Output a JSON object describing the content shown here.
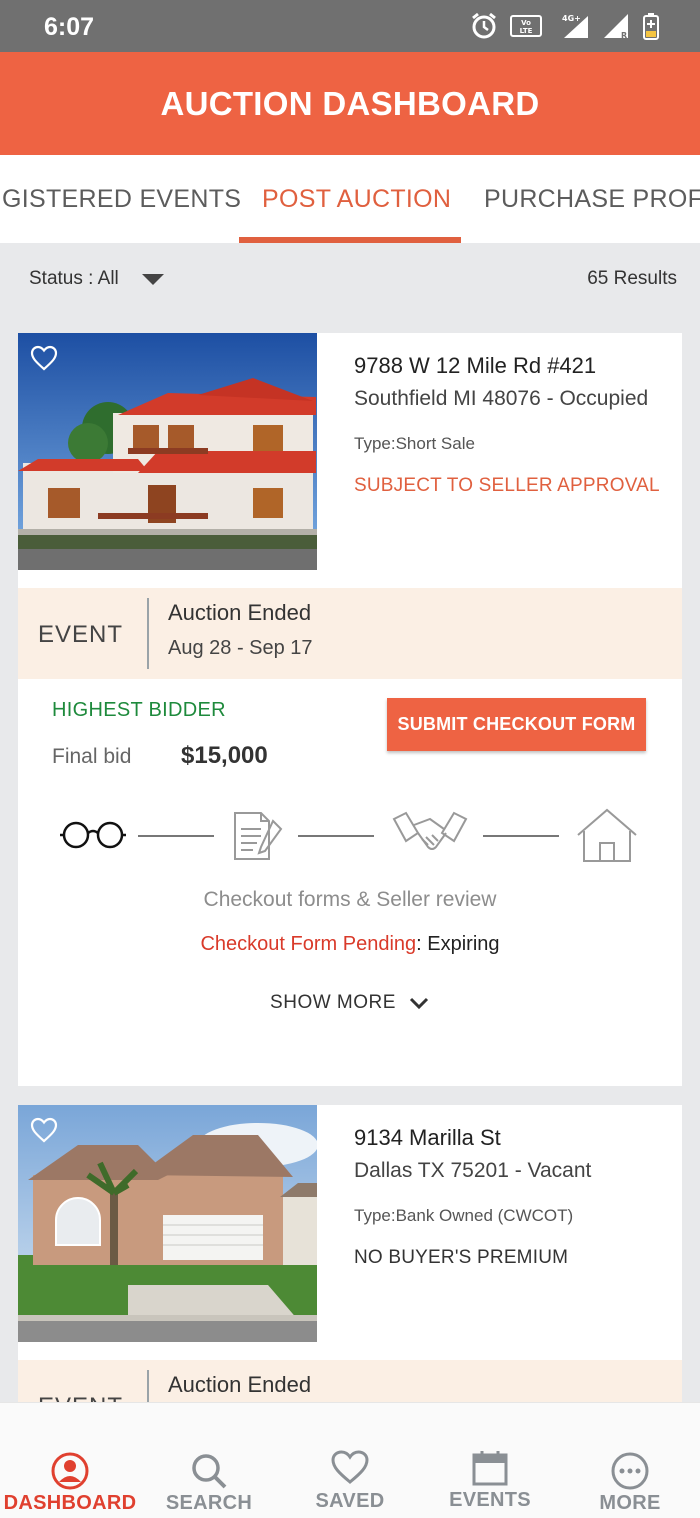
{
  "status_bar": {
    "time": "6:07",
    "network_label": "4G+",
    "volte_label": "VoLTE"
  },
  "app_bar": {
    "title": "AUCTION DASHBOARD"
  },
  "tabs": [
    {
      "label": "GISTERED EVENTS"
    },
    {
      "label": "POST AUCTION"
    },
    {
      "label": "PURCHASE PROFIL"
    }
  ],
  "filter": {
    "status_label": "Status : All",
    "results": "65 Results"
  },
  "listings": [
    {
      "address_line1": "9788 W 12 Mile Rd #421",
      "address_line2": "Southfield MI 48076 - Occupied",
      "type": "Type:Short Sale",
      "tag": "SUBJECT TO SELLER APPROVAL",
      "event_label": "EVENT",
      "event_status": "Auction Ended",
      "event_dates": "Aug 28 - Sep 17",
      "bid_status": "HIGHEST BIDDER",
      "final_bid_label": "Final bid",
      "final_bid_value": "$15,000",
      "cta": "SUBMIT CHECKOUT FORM",
      "step_caption": "Checkout forms & Seller review",
      "pending_label": "Checkout Form Pending",
      "pending_suffix": ": Expiring",
      "show_more": "SHOW MORE"
    },
    {
      "address_line1": "9134 Marilla St",
      "address_line2": "Dallas TX 75201 - Vacant",
      "type": "Type:Bank Owned (CWCOT)",
      "tag": "NO BUYER'S PREMIUM",
      "event_label": "EVENT",
      "event_status": "Auction Ended"
    }
  ],
  "bottom_nav": [
    {
      "label": "DASHBOARD",
      "icon": "profile-icon",
      "active": true
    },
    {
      "label": "SEARCH",
      "icon": "search-icon"
    },
    {
      "label": "SAVED",
      "icon": "heart-icon"
    },
    {
      "label": "EVENTS",
      "icon": "calendar-icon"
    },
    {
      "label": "MORE",
      "icon": "more-icon"
    }
  ],
  "colors": {
    "brand": "#ee6343",
    "accent": "#e0603f",
    "success": "#1e8a3c",
    "danger": "#d93a2a",
    "event_band": "#fbefe4"
  }
}
